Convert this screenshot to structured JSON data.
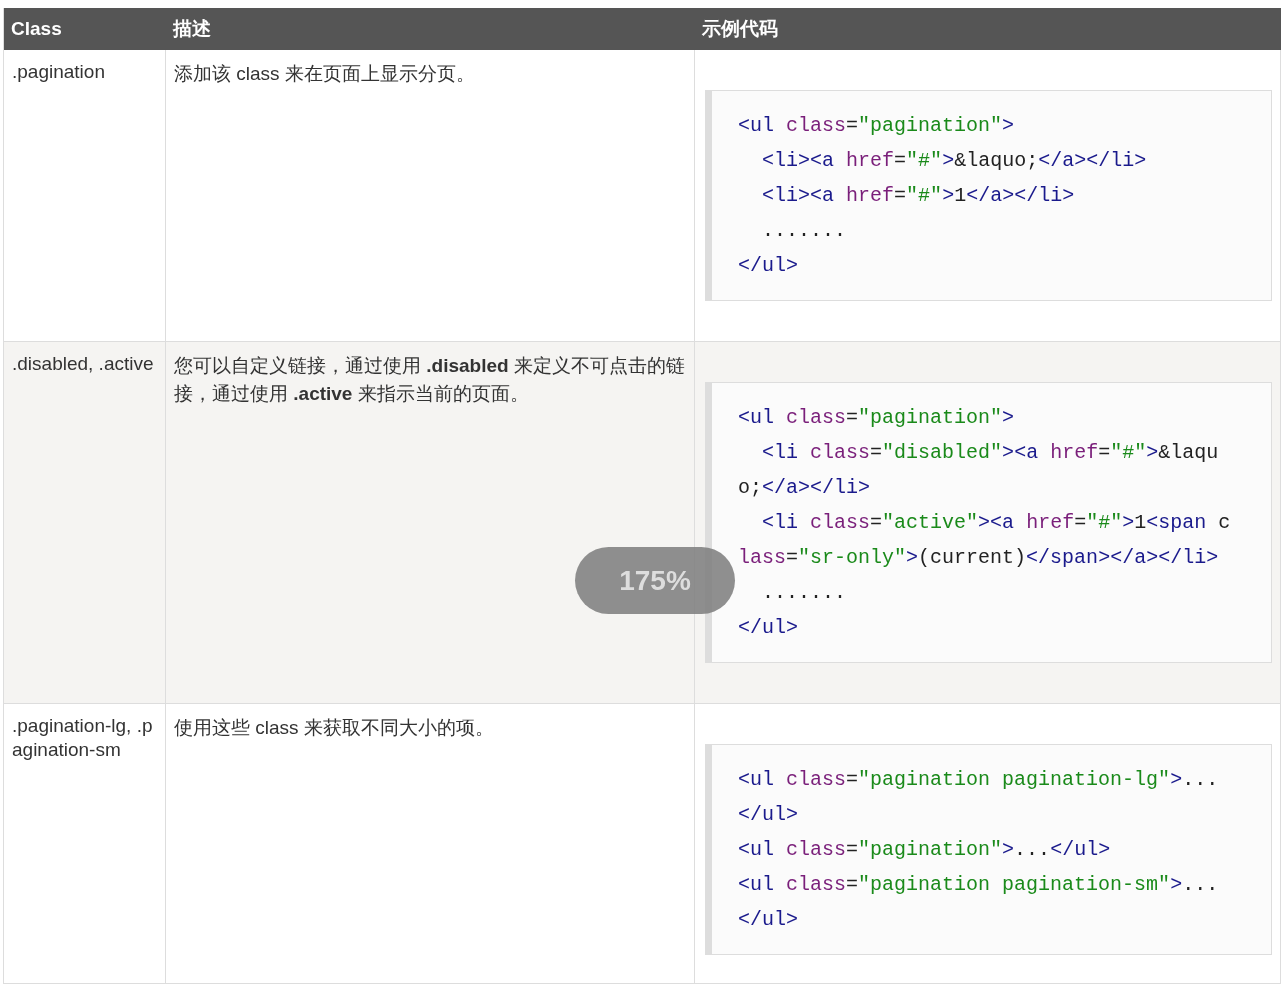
{
  "table": {
    "columns": [
      "Class",
      "描述",
      "示例代码"
    ],
    "rows": [
      {
        "class": ".pagination",
        "shaded": false,
        "description": "添加该 class 来在页面上显示分页。",
        "code": [
          "<ul class=\"pagination\">",
          "  <li><a href=\"#\">&laquo;</a></li>",
          "  <li><a href=\"#\">1</a></li>",
          "  .......",
          "</ul>"
        ]
      },
      {
        "class": ".disabled, .active",
        "shaded": true,
        "description": "您可以自定义链接，通过使用 **.disabled** 来定义不可点击的链接，通过使用 **.active** 来指示当前的页面。",
        "code": [
          "<ul class=\"pagination\">",
          "  <li class=\"disabled\"><a href=\"#\">&laqu",
          "o;</a></li>",
          "  <li class=\"active\"><a href=\"#\">1<span c",
          "lass=\"sr-only\">(current)</span></a></li>",
          "  .......",
          "</ul>"
        ]
      },
      {
        "class": ".pagination-lg, .pagination-sm",
        "shaded": false,
        "description": "使用这些 class 来获取不同大小的项。",
        "code": [
          "<ul class=\"pagination pagination-lg\">...",
          "</ul>",
          "<ul class=\"pagination\">...</ul>",
          "<ul class=\"pagination pagination-sm\">...",
          "</ul>"
        ]
      }
    ]
  },
  "zoom_indicator": {
    "label": "175%"
  }
}
